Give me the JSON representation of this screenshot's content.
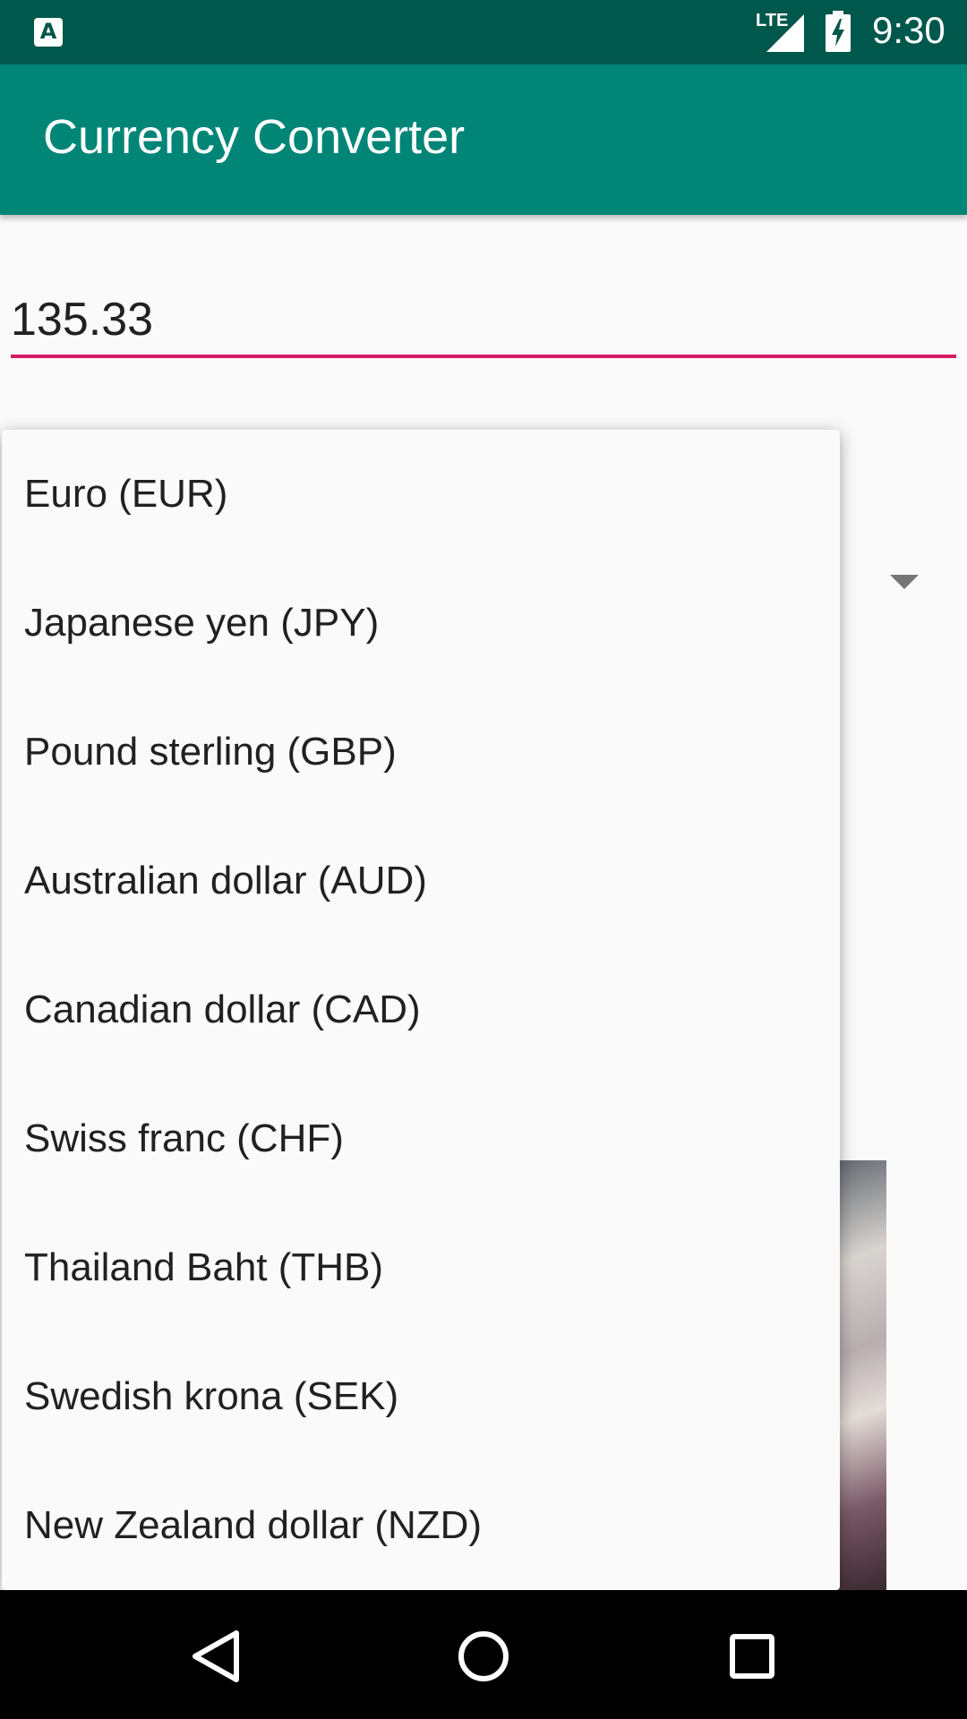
{
  "status_bar": {
    "app_icon": "A",
    "network": "LTE",
    "time": "9:30"
  },
  "app_bar": {
    "title": "Currency Converter"
  },
  "amount_input": {
    "value": "135.33"
  },
  "dropdown": {
    "options": [
      "Euro (EUR)",
      "Japanese yen (JPY)",
      "Pound sterling (GBP)",
      "Australian dollar (AUD)",
      "Canadian dollar (CAD)",
      "Swiss franc (CHF)",
      "Thailand Baht (THB)",
      "Swedish krona (SEK)",
      "New Zealand dollar (NZD)"
    ]
  },
  "colors": {
    "status_bar": "#00574b",
    "app_bar": "#008577",
    "accent": "#d81b60"
  },
  "icons": {
    "status": [
      "app-notification-icon",
      "lte-signal-icon",
      "battery-charging-icon"
    ],
    "nav": [
      "back-icon",
      "home-icon",
      "recents-icon"
    ],
    "spinner": "dropdown-arrow-icon"
  }
}
